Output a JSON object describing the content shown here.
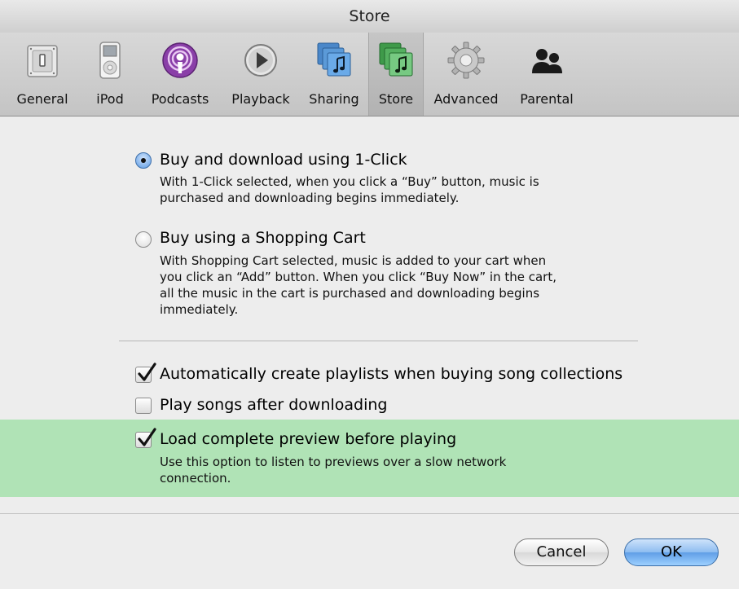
{
  "window": {
    "title": "Store"
  },
  "toolbar": {
    "items": [
      {
        "label": "General",
        "icon": "general-switch-icon"
      },
      {
        "label": "iPod",
        "icon": "ipod-icon"
      },
      {
        "label": "Podcasts",
        "icon": "podcast-icon"
      },
      {
        "label": "Playback",
        "icon": "playback-icon"
      },
      {
        "label": "Sharing",
        "icon": "sharing-icon"
      },
      {
        "label": "Store",
        "icon": "store-icon",
        "selected": true
      },
      {
        "label": "Advanced",
        "icon": "gear-icon"
      },
      {
        "label": "Parental",
        "icon": "parental-icon"
      }
    ]
  },
  "purchase": {
    "one_click": {
      "label": "Buy and download using 1-Click",
      "selected": true,
      "desc_line1": "With 1-Click selected, when you click a “Buy” button, music is",
      "desc_line2": "purchased and downloading begins immediately."
    },
    "cart": {
      "label": "Buy using a Shopping Cart",
      "selected": false,
      "desc_line1": "With Shopping Cart selected, music is added to your cart when",
      "desc_line2": "you click an “Add” button. When you click “Buy Now” in the cart,",
      "desc_line3": "all the music in the cart is purchased and downloading begins",
      "desc_line4": "immediately."
    }
  },
  "options": {
    "auto_playlists": {
      "label": "Automatically create playlists when buying song collections",
      "checked": true
    },
    "play_after": {
      "label": "Play songs after downloading",
      "checked": false
    },
    "load_preview": {
      "label": "Load complete preview before playing",
      "checked": true,
      "desc_line1": "Use this option to listen to previews over a slow network",
      "desc_line2": "connection."
    }
  },
  "buttons": {
    "cancel": "Cancel",
    "ok": "OK"
  },
  "colors": {
    "highlight": "#a4e0ab",
    "default_button": "#5f9ee6",
    "selected_tab": "#b8b8b8"
  }
}
